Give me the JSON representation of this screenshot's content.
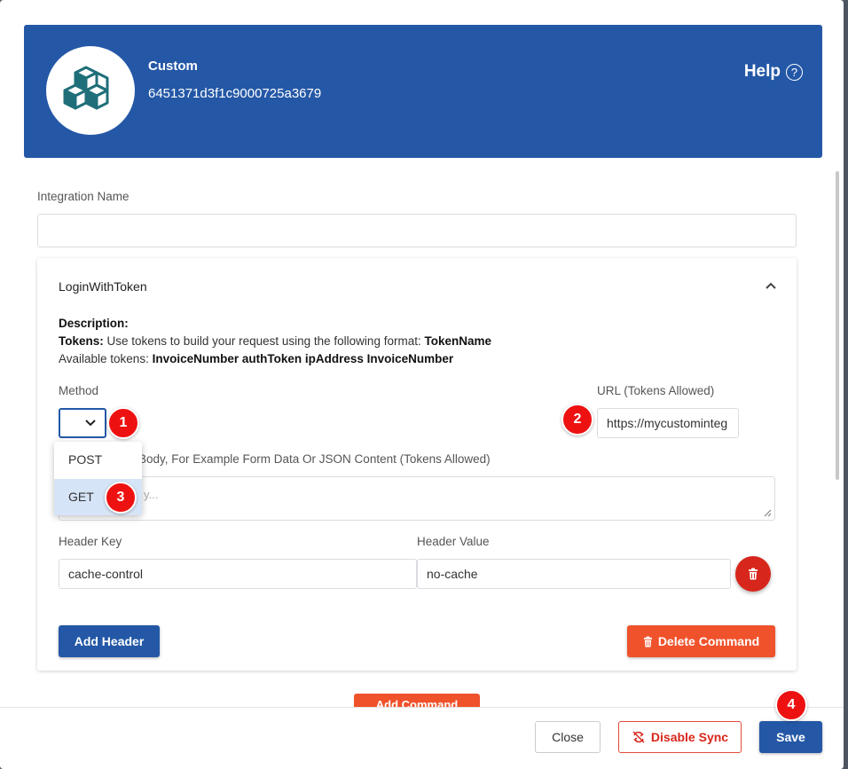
{
  "header": {
    "title": "Custom",
    "id": "6451371d3f1c9000725a3679",
    "help_label": "Help",
    "help_icon_glyph": "?",
    "color": "#2458a6"
  },
  "form": {
    "integration_name_label": "Integration Name",
    "integration_name_value": ""
  },
  "command": {
    "name": "LoginWithToken",
    "description_label": "Description:",
    "tokens_label": "Tokens:",
    "tokens_text": " Use tokens to build your request using the following format: ",
    "tokens_format": "TokenName",
    "available_label": "Available tokens: ",
    "available_tokens": "InvoiceNumber authToken ipAddress InvoiceNumber",
    "method_label": "Method",
    "method_value": "",
    "method_options": [
      "POST",
      "GET"
    ],
    "url_label": "URL (Tokens Allowed)",
    "url_value": "https://mycustominteg",
    "body_label": "Body, For Example Form Data Or JSON Content (Tokens Allowed)",
    "body_placeholder": "y...",
    "header_key_label": "Header Key",
    "header_value_label": "Header Value",
    "header_key_value": "cache-control",
    "header_value_value": "no-cache",
    "add_header_label": "Add Header",
    "delete_command_label": "Delete Command"
  },
  "add_command_label": "Add Command",
  "footer": {
    "close_label": "Close",
    "disable_sync_label": "Disable Sync",
    "save_label": "Save"
  },
  "badges": [
    "1",
    "2",
    "3",
    "4"
  ],
  "colors": {
    "primary": "#2458a6",
    "danger": "#f0522b",
    "danger_dark": "#d7261b",
    "badge": "#ee1111"
  }
}
